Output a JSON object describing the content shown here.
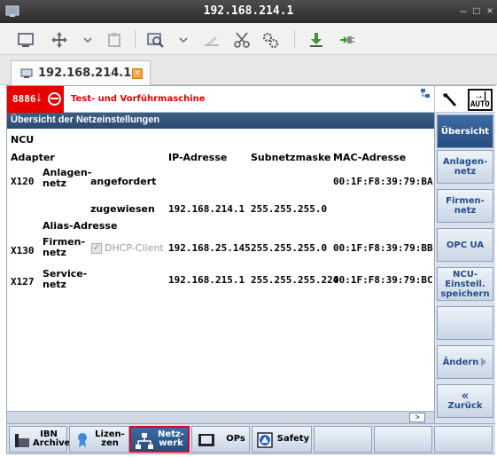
{
  "window": {
    "title": "192.168.214.1",
    "min_label": "–",
    "max_label": "□",
    "close_label": "×"
  },
  "tab": {
    "label": "192.168.214.1"
  },
  "header": {
    "alarm_number": "8886",
    "alarm_text": "Test- und Vorführmaschine",
    "mode_label": "AUTO"
  },
  "panel": {
    "title": "Übersicht der Netzeinstellungen"
  },
  "table": {
    "ncu_label": "NCU",
    "adapter_label": "Adapter",
    "col_ip": "IP-Adresse",
    "col_mask": "Subnetzmaske",
    "col_mac": "MAC-Adresse",
    "alias_label": "Alias-Adresse",
    "rows": [
      {
        "port": "X120",
        "net1": "Anlagen-",
        "net2": "netz",
        "mode": "angefordert",
        "ip": "",
        "mask": "",
        "mac": "00:1F:F8:39:79:BA"
      },
      {
        "port": "",
        "net1": "",
        "net2": "",
        "mode": "zugewiesen",
        "ip": "192.168.214.1",
        "mask": "255.255.255.0",
        "mac": ""
      },
      {
        "port": "X130",
        "net1": "Firmen-",
        "net2": "netz",
        "mode": "DHCP-Client",
        "ip": "192.168.25.145",
        "mask": "255.255.255.0",
        "mac": "00:1F:F8:39:79:BB"
      },
      {
        "port": "X127",
        "net1": "Service-",
        "net2": "netz",
        "mode": "",
        "ip": "192.168.215.1",
        "mask": "255.255.255.224",
        "mac": "00:1F:F8:39:79:BC"
      }
    ]
  },
  "softkeys_vertical": {
    "overview": "Übersicht",
    "plant1": "Anlagen-",
    "plant2": "netz",
    "company1": "Firmen-",
    "company2": "netz",
    "opcua": "OPC UA",
    "ncu1": "NCU-Einstell.",
    "ncu2": "speichern",
    "change": "Ändern",
    "back_arrow": "«",
    "back": "Zurück"
  },
  "softkeys_horizontal": {
    "ibn1": "IBN",
    "ibn2": "Archive",
    "lic1": "Lizen-",
    "lic2": "zen",
    "net1": "Netz-",
    "net2": "werk",
    "ops": "OPs",
    "safety": "Safety"
  },
  "colors": {
    "alarm": "#e60000",
    "panel": "#2f5078",
    "softkey_text": "#234e89",
    "active_border": "#e0002a"
  }
}
